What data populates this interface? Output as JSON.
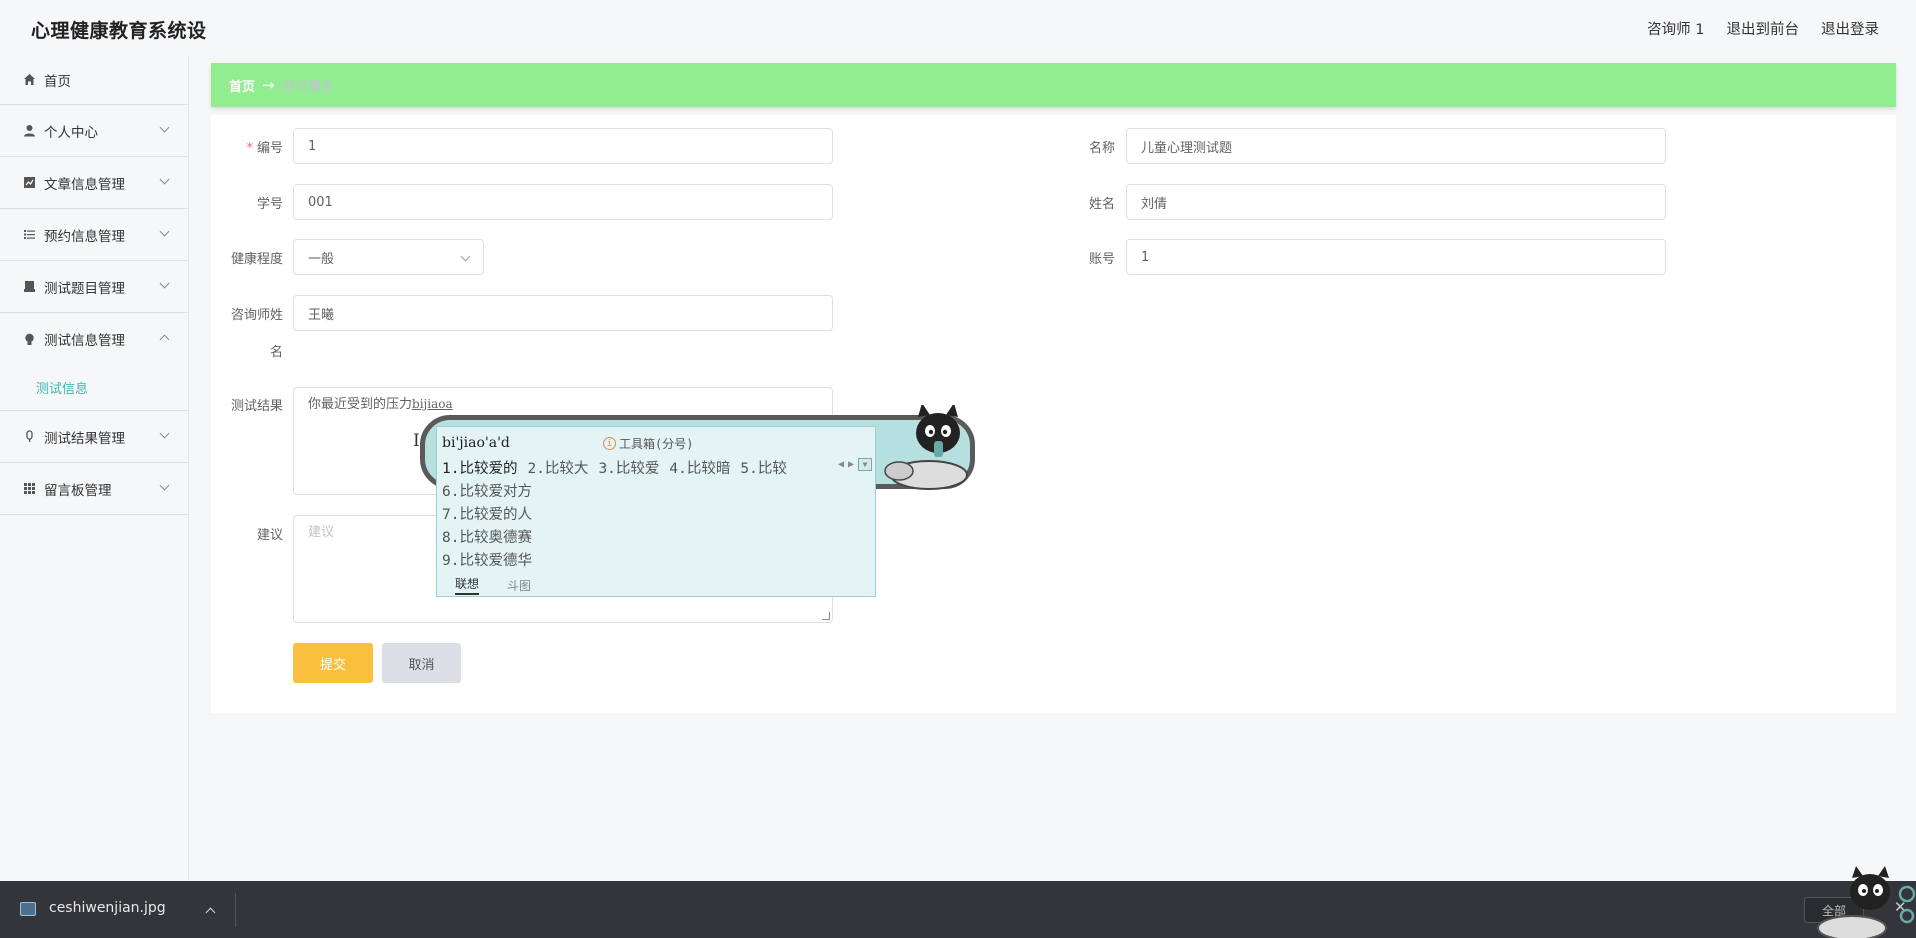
{
  "header": {
    "app_title": "心理健康教育系统设",
    "user": "咨询师 1",
    "to_front": "退出到前台",
    "logout": "退出登录"
  },
  "sidebar": {
    "items": [
      {
        "label": "首页",
        "icon": "home-icon"
      },
      {
        "label": "个人中心",
        "icon": "user-icon"
      },
      {
        "label": "文章信息管理",
        "icon": "chart-icon"
      },
      {
        "label": "预约信息管理",
        "icon": "list-icon"
      },
      {
        "label": "测试题目管理",
        "icon": "printer-icon"
      },
      {
        "label": "测试信息管理",
        "icon": "bulb-icon"
      },
      {
        "label": "测试结果管理",
        "icon": "mic-icon"
      },
      {
        "label": "留言板管理",
        "icon": "grid-icon"
      }
    ],
    "active_sub": "测试信息"
  },
  "breadcrumb": {
    "home": "首页",
    "arrow": "→",
    "current": "测试信息"
  },
  "form": {
    "id_label": "编号",
    "id_value": "1",
    "name_label": "名称",
    "name_value": "儿童心理测试题",
    "student_no_label": "学号",
    "student_no_value": "001",
    "student_name_label": "姓名",
    "student_name_value": "刘倩",
    "health_label": "健康程度",
    "health_value": "一般",
    "account_label": "账号",
    "account_value": "1",
    "counselor_label_1": "咨询师姓",
    "counselor_label_2": "名",
    "counselor_value": "王曦",
    "result_label": "测试结果",
    "result_value": "你最近受到的压力",
    "result_composing": "bijiaoa",
    "advice_label": "建议",
    "advice_placeholder": "建议",
    "submit": "提交",
    "cancel": "取消"
  },
  "ime": {
    "composition": "bi'jiao'a'd",
    "toolbox": "工具箱(分号)",
    "row1": [
      "1.比较爱的",
      "2.比较大",
      "3.比较爱",
      "4.比较暗",
      "5.比较"
    ],
    "more": [
      "6.比较爱对方",
      "7.比较爱的人",
      "8.比较奥德赛",
      "9.比较爱德华"
    ],
    "tab_active": "联想",
    "tab_other": "斗图"
  },
  "download_bar": {
    "file_name": "ceshiwenjian.jpg",
    "show_all": "全部"
  },
  "colors": {
    "breadcrumb_bg": "#90ee90",
    "active_sub": "#3bb8b3",
    "submit_btn": "#fac03d",
    "required": "#f56c6c"
  }
}
